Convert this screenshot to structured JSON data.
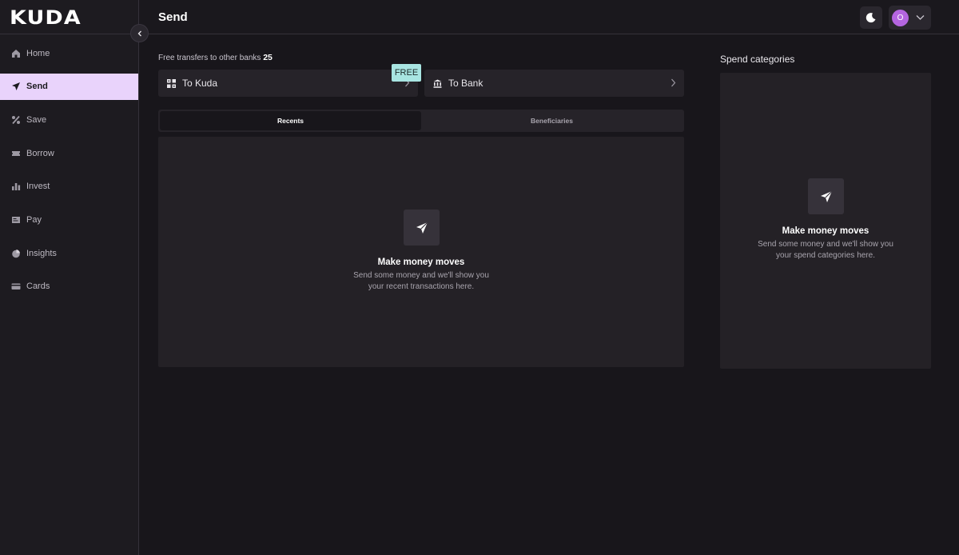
{
  "app": {
    "logo_text": "KUDA"
  },
  "header": {
    "title": "Send",
    "avatar_initial": "O"
  },
  "sidebar": {
    "items": [
      {
        "label": "Home",
        "icon": "home-icon"
      },
      {
        "label": "Send",
        "icon": "send-icon",
        "active": true
      },
      {
        "label": "Save",
        "icon": "percent-icon"
      },
      {
        "label": "Borrow",
        "icon": "ticket-icon"
      },
      {
        "label": "Invest",
        "icon": "bar-chart-icon"
      },
      {
        "label": "Pay",
        "icon": "bill-icon"
      },
      {
        "label": "Insights",
        "icon": "pie-chart-icon"
      },
      {
        "label": "Cards",
        "icon": "card-icon"
      }
    ]
  },
  "main": {
    "free_transfers_label": "Free transfers to other banks",
    "free_transfers_count": "25",
    "options": [
      {
        "label": "To Kuda",
        "icon": "kuda-grid-icon"
      },
      {
        "label": "To Bank",
        "icon": "bank-icon"
      }
    ],
    "free_badge": "FREE",
    "tabs": [
      {
        "label": "Recents",
        "active": true
      },
      {
        "label": "Beneficiaries",
        "active": false
      }
    ],
    "recents_empty": {
      "title": "Make money moves",
      "desc_line1": "Send some money and we'll show you",
      "desc_line2": "your recent transactions here."
    }
  },
  "spend": {
    "title": "Spend categories",
    "empty": {
      "title": "Make money moves",
      "desc_line1": "Send some money and we'll show you",
      "desc_line2": "your spend categories here."
    }
  },
  "colors": {
    "background": "#18161b",
    "sidebar_active": "#e9d3fb",
    "free_badge": "#a8e5e2",
    "avatar": "#b465e0"
  }
}
